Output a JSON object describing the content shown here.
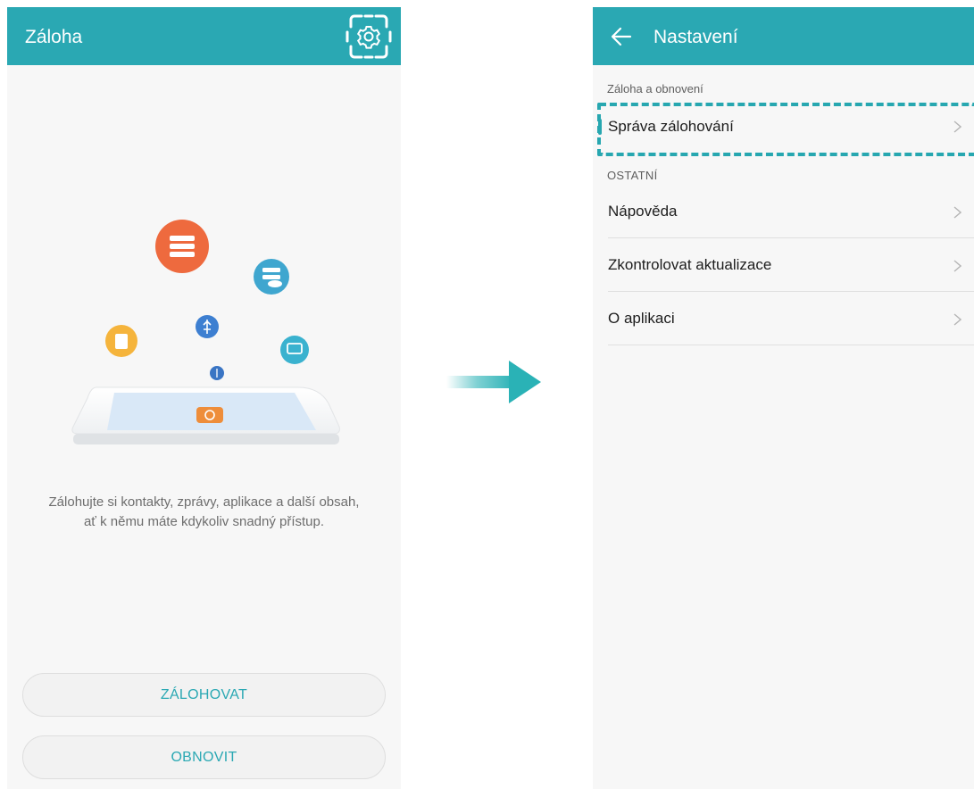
{
  "left_screen": {
    "title": "Záloha",
    "description_line1": "Zálohujte si kontakty, zprávy, aplikace a další obsah,",
    "description_line2": "ať k němu máte kdykoliv snadný přístup.",
    "backup_button": "ZÁLOHOVAT",
    "restore_button": "OBNOVIT"
  },
  "right_screen": {
    "title": "Nastavení",
    "section_backup": "Záloha a obnovení",
    "manage_backups": "Správa zálohování",
    "section_other": "OSTATNÍ",
    "items": [
      {
        "label": "Nápověda"
      },
      {
        "label": "Zkontrolovat aktualizace"
      },
      {
        "label": "O aplikaci"
      }
    ]
  },
  "colors": {
    "accent": "#2aa8b3",
    "background": "#f7f7f7",
    "text_primary": "#1d1d1d",
    "text_secondary": "#6d6d6d"
  },
  "icons": [
    "settings-gear-icon",
    "back-arrow-icon",
    "chevron-right-icon",
    "flow-arrow-icon"
  ]
}
